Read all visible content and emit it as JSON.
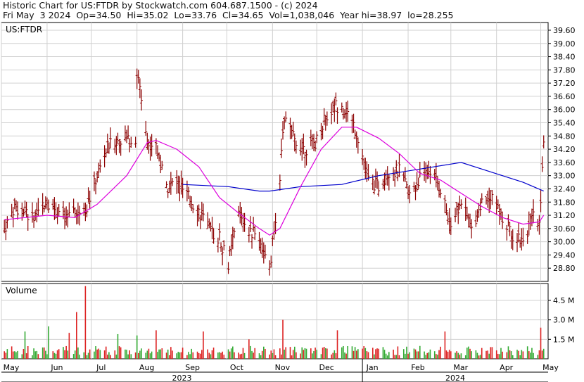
{
  "header": {
    "line1": "Historic Chart for US:FTDR by Stockwatch.com 604.687.1500 - (c) 2024",
    "line2": "Fri May  3 2024  Op=34.50  Hi=35.02  Lo=33.76  Cl=34.65  Vol=1,038,046  Year hi=38.97  lo=28.255"
  },
  "chart_data": {
    "type": "ohlc",
    "symbol_label": "US:FTDR",
    "volume_label": "Volume",
    "price_ticks": [
      "39.60",
      "39.00",
      "38.40",
      "37.80",
      "37.20",
      "36.60",
      "36.00",
      "35.40",
      "34.80",
      "34.20",
      "33.60",
      "33.00",
      "32.40",
      "31.80",
      "31.20",
      "30.60",
      "30.00",
      "29.40",
      "28.80"
    ],
    "price_range": [
      28.2,
      39.95
    ],
    "volume_ticks": [
      "4.5 M",
      "3.0 M",
      "1.5 M"
    ],
    "volume_range": [
      0,
      5.8
    ],
    "months": [
      "May",
      "Jun",
      "Jul",
      "Aug",
      "Sep",
      "Oct",
      "Nov",
      "Dec",
      "Jan",
      "Feb",
      "Mar",
      "Apr",
      "May"
    ],
    "years": [
      "2023",
      "2024"
    ],
    "colors": {
      "bar": "#8b0000",
      "vol": "#dd2222",
      "vol_alt": "#33aa33",
      "ma_short": "#dd00dd",
      "ma_long": "#0000cc",
      "grid": "#d0d0d0"
    },
    "price_anchors": [
      [
        "2023-05-03",
        30.6
      ],
      [
        "2023-05-10",
        31.6
      ],
      [
        "2023-05-17",
        31.3
      ],
      [
        "2023-05-24",
        31.0
      ],
      [
        "2023-05-31",
        31.9
      ],
      [
        "2023-06-07",
        31.5
      ],
      [
        "2023-06-14",
        31.0
      ],
      [
        "2023-06-21",
        31.3
      ],
      [
        "2023-06-28",
        31.6
      ],
      [
        "2023-07-05",
        33.0
      ],
      [
        "2023-07-12",
        34.3
      ],
      [
        "2023-07-19",
        34.6
      ],
      [
        "2023-07-26",
        34.7
      ],
      [
        "2023-07-31",
        34.7
      ],
      [
        "2023-08-01",
        37.5
      ],
      [
        "2023-08-03",
        37.1
      ],
      [
        "2023-08-08",
        34.5
      ],
      [
        "2023-08-14",
        34.3
      ],
      [
        "2023-08-21",
        32.5
      ],
      [
        "2023-08-28",
        32.7
      ],
      [
        "2023-09-05",
        32.0
      ],
      [
        "2023-09-12",
        31.4
      ],
      [
        "2023-09-19",
        30.5
      ],
      [
        "2023-09-26",
        30.2
      ],
      [
        "2023-10-02",
        29.0
      ],
      [
        "2023-10-09",
        31.3
      ],
      [
        "2023-10-16",
        30.5
      ],
      [
        "2023-10-23",
        30.2
      ],
      [
        "2023-10-30",
        28.6
      ],
      [
        "2023-11-06",
        33.0
      ],
      [
        "2023-11-09",
        35.6
      ],
      [
        "2023-11-16",
        34.6
      ],
      [
        "2023-11-23",
        34.2
      ],
      [
        "2023-11-30",
        34.5
      ],
      [
        "2023-12-07",
        35.6
      ],
      [
        "2023-12-14",
        36.2
      ],
      [
        "2023-12-21",
        36.0
      ],
      [
        "2023-12-28",
        35.0
      ],
      [
        "2024-01-05",
        32.8
      ],
      [
        "2024-01-12",
        32.5
      ],
      [
        "2024-01-19",
        33.2
      ],
      [
        "2024-01-26",
        33.2
      ],
      [
        "2024-02-02",
        32.1
      ],
      [
        "2024-02-09",
        32.9
      ],
      [
        "2024-02-16",
        33.3
      ],
      [
        "2024-02-23",
        32.4
      ],
      [
        "2024-03-01",
        30.8
      ],
      [
        "2024-03-08",
        31.8
      ],
      [
        "2024-03-15",
        30.6
      ],
      [
        "2024-03-22",
        31.8
      ],
      [
        "2024-03-29",
        32.2
      ],
      [
        "2024-04-05",
        31.0
      ],
      [
        "2024-04-12",
        30.3
      ],
      [
        "2024-04-19",
        30.1
      ],
      [
        "2024-04-26",
        31.1
      ],
      [
        "2024-04-30",
        30.8
      ],
      [
        "2024-05-03",
        34.65
      ]
    ],
    "ma_short": [
      [
        "2023-05-03",
        31.0
      ],
      [
        "2023-06-01",
        31.2
      ],
      [
        "2023-06-20",
        31.1
      ],
      [
        "2023-07-05",
        31.7
      ],
      [
        "2023-07-25",
        33.0
      ],
      [
        "2023-08-08",
        34.5
      ],
      [
        "2023-08-14",
        34.6
      ],
      [
        "2023-08-28",
        34.2
      ],
      [
        "2023-09-12",
        33.4
      ],
      [
        "2023-09-26",
        32.0
      ],
      [
        "2023-10-09",
        31.3
      ],
      [
        "2023-10-23",
        30.6
      ],
      [
        "2023-10-30",
        30.3
      ],
      [
        "2023-11-06",
        30.6
      ],
      [
        "2023-11-20",
        32.5
      ],
      [
        "2023-12-04",
        34.2
      ],
      [
        "2023-12-18",
        35.2
      ],
      [
        "2023-12-28",
        35.2
      ],
      [
        "2024-01-12",
        34.7
      ],
      [
        "2024-01-26",
        34.0
      ],
      [
        "2024-02-09",
        33.1
      ],
      [
        "2024-02-23",
        32.8
      ],
      [
        "2024-03-08",
        32.2
      ],
      [
        "2024-03-22",
        31.6
      ],
      [
        "2024-04-05",
        31.1
      ],
      [
        "2024-04-19",
        30.8
      ],
      [
        "2024-04-30",
        30.9
      ],
      [
        "2024-05-03",
        31.2
      ]
    ],
    "ma_long": [
      [
        "2023-09-01",
        32.6
      ],
      [
        "2023-10-02",
        32.5
      ],
      [
        "2023-10-23",
        32.3
      ],
      [
        "2023-10-30",
        32.3
      ],
      [
        "2023-11-20",
        32.5
      ],
      [
        "2023-12-18",
        32.6
      ],
      [
        "2024-01-12",
        33.0
      ],
      [
        "2024-02-09",
        33.3
      ],
      [
        "2024-03-08",
        33.6
      ],
      [
        "2024-03-22",
        33.3
      ],
      [
        "2024-04-05",
        33.0
      ],
      [
        "2024-04-19",
        32.7
      ],
      [
        "2024-05-03",
        32.3
      ]
    ],
    "volume_spikes": [
      [
        "2023-05-17",
        2.1
      ],
      [
        "2023-06-02",
        2.5
      ],
      [
        "2023-06-16",
        2.0
      ],
      [
        "2023-06-21",
        3.6
      ],
      [
        "2023-06-27",
        5.6
      ],
      [
        "2023-07-19",
        1.9
      ],
      [
        "2023-08-01",
        1.8
      ],
      [
        "2023-08-14",
        2.2
      ],
      [
        "2023-09-15",
        2.1
      ],
      [
        "2023-10-16",
        1.5
      ],
      [
        "2023-11-08",
        3.0
      ],
      [
        "2023-12-15",
        2.2
      ],
      [
        "2024-02-26",
        2.1
      ],
      [
        "2024-05-01",
        2.4
      ]
    ]
  }
}
